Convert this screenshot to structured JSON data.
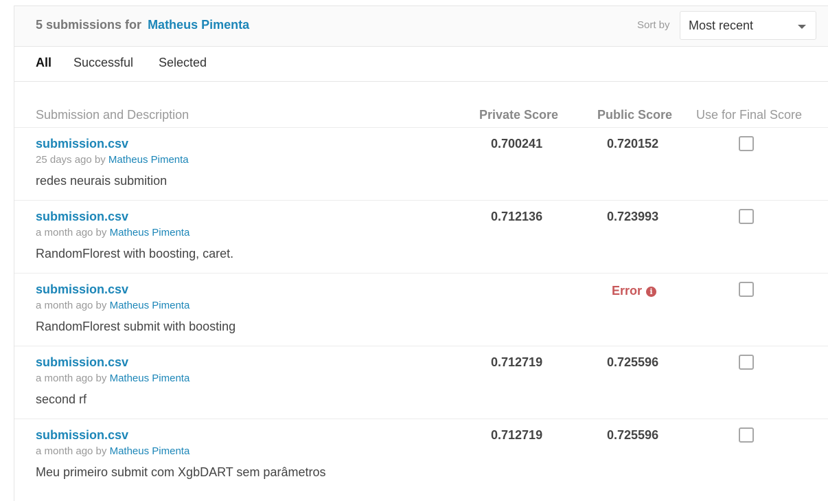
{
  "header": {
    "title_prefix": "5 submissions for",
    "user": "Matheus Pimenta",
    "sort_label": "Sort by",
    "sort_value": "Most recent"
  },
  "tabs": [
    {
      "label": "All",
      "active": true
    },
    {
      "label": "Successful",
      "active": false
    },
    {
      "label": "Selected",
      "active": false
    }
  ],
  "columns": {
    "submission": "Submission and Description",
    "private": "Private Score",
    "public": "Public Score",
    "final": "Use for Final Score"
  },
  "submissions": [
    {
      "file": "submission.csv",
      "time": "25 days ago by",
      "by": "Matheus Pimenta",
      "description": "redes neurais submition",
      "private_score": "0.700241",
      "public_score": "0.720152",
      "error": "",
      "selected": false
    },
    {
      "file": "submission.csv",
      "time": "a month ago by",
      "by": "Matheus Pimenta",
      "description": "RandomFlorest with boosting, caret.",
      "private_score": "0.712136",
      "public_score": "0.723993",
      "error": "",
      "selected": false
    },
    {
      "file": "submission.csv",
      "time": "a month ago by",
      "by": "Matheus Pimenta",
      "description": "RandomFlorest submit with boosting",
      "private_score": "",
      "public_score": "",
      "error": "Error",
      "selected": false
    },
    {
      "file": "submission.csv",
      "time": "a month ago by",
      "by": "Matheus Pimenta",
      "description": "second rf",
      "private_score": "0.712719",
      "public_score": "0.725596",
      "error": "",
      "selected": false
    },
    {
      "file": "submission.csv",
      "time": "a month ago by",
      "by": "Matheus Pimenta",
      "description": "Meu primeiro submit com XgbDART sem parâmetros",
      "private_score": "0.712719",
      "public_score": "0.725596",
      "error": "",
      "selected": false
    }
  ],
  "colors": {
    "link": "#1c86b8",
    "error": "#c8585a",
    "muted": "#999999"
  }
}
